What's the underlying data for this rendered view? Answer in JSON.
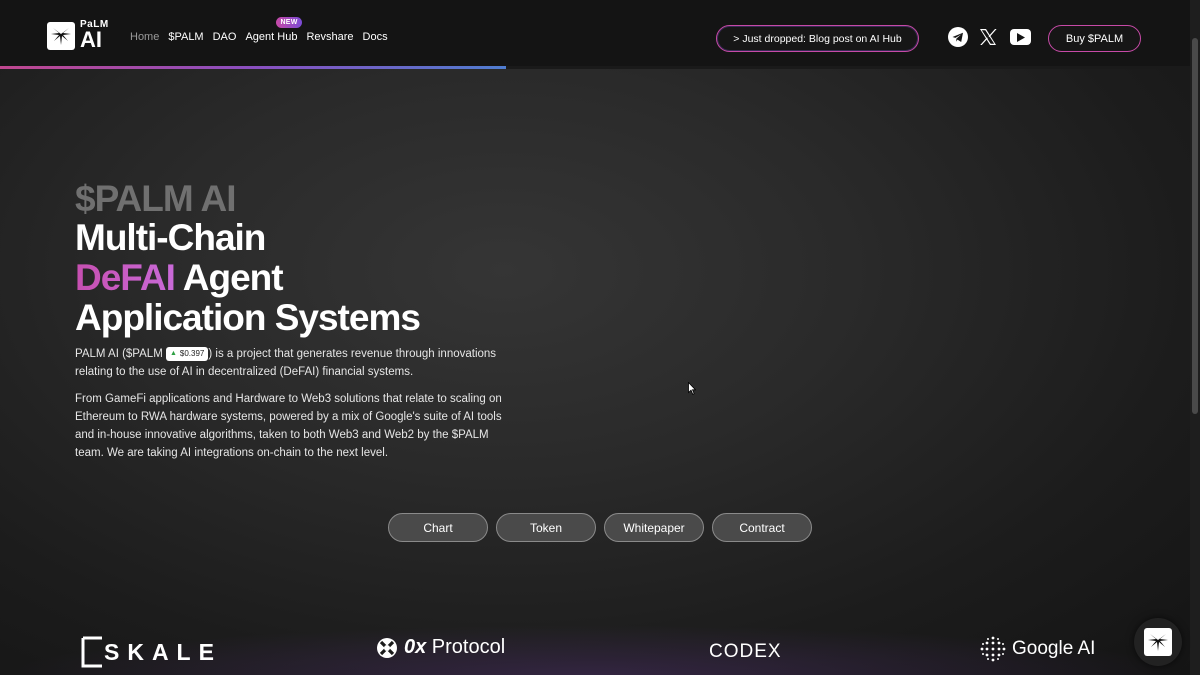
{
  "brand": {
    "logo_small": "PaLM",
    "logo_big": "AI"
  },
  "nav": {
    "items": [
      {
        "label": "Home",
        "active": true
      },
      {
        "label": "$PALM"
      },
      {
        "label": "DAO"
      },
      {
        "label": "Agent Hub",
        "badge": "NEW"
      },
      {
        "label": "Revshare"
      },
      {
        "label": "Docs"
      }
    ]
  },
  "announcement": "> Just dropped: Blog post on AI Hub",
  "social": [
    "telegram-icon",
    "x-icon",
    "youtube-icon"
  ],
  "buy_label": "Buy $PALM",
  "scroll_progress": 0.425,
  "hero": {
    "kicker": "$PALM AI",
    "title_line1": "Multi-Chain",
    "title_accent": "DeFAI",
    "title_line2_rest": " Agent",
    "title_line3": "Application Systems",
    "para1_prefix": "PALM AI ($PALM ",
    "price": "$0.397",
    "para1_suffix": ") is a project that generates revenue through innovations relating to the use of AI in decentralized (DeFAI) financial systems.",
    "para2": "From GameFi applications and Hardware to Web3 solutions that relate to scaling on Ethereum to RWA hardware systems, powered by a mix of Google's suite of AI tools and in-house innovative algorithms, taken to both Web3 and Web2 by the $PALM team. We are taking AI integrations on-chain to the next level."
  },
  "buttons": {
    "chart": "Chart",
    "token": "Token",
    "whitepaper": "Whitepaper",
    "contract": "Contract"
  },
  "partners": {
    "skale": "SKALE",
    "zx_bold": "0x",
    "zx_rest": " Protocol",
    "codex": "CODEX",
    "google": "Google AI"
  },
  "colors": {
    "accent_pink": "#c74aa7",
    "accent_purple": "#7a4bd6",
    "background": "#1c1c1c"
  }
}
